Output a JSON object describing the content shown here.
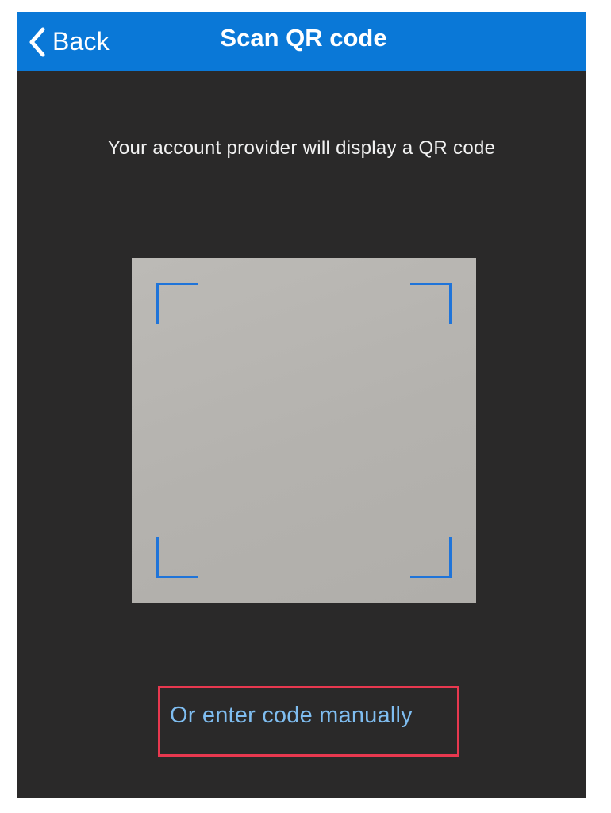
{
  "navbar": {
    "back_label": "Back",
    "title": "Scan QR code",
    "background_color": "#0a78d7",
    "back_icon": "chevron-left-icon"
  },
  "main": {
    "instruction": "Your account provider will display a QR code",
    "manual_entry_link": "Or enter code manually",
    "link_color": "#7fbdf0",
    "highlight_color": "#e8384f",
    "frame_color": "#1f74d9"
  }
}
